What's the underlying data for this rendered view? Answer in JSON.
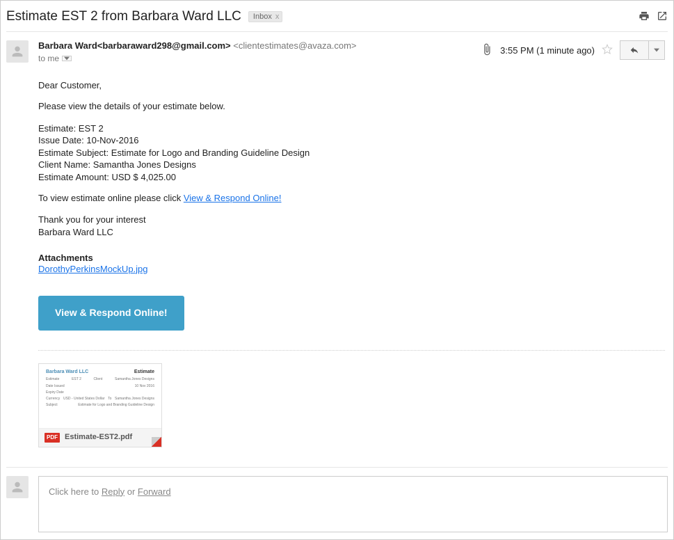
{
  "subject": "Estimate EST 2 from Barbara Ward LLC",
  "inbox_tag": "Inbox",
  "from": {
    "display": "Barbara Ward<barbaraward298@gmail.com>",
    "via": "<clientestimates@avaza.com>"
  },
  "to_line": "to me",
  "time": "3:55 PM (1 minute ago)",
  "body": {
    "greeting": "Dear Customer,",
    "intro": "Please view the details of your estimate below.",
    "lines": {
      "estimate": "Estimate: EST 2",
      "issue_date": "Issue Date: 10-Nov-2016",
      "subject": "Estimate Subject: Estimate for Logo and Branding Guideline Design",
      "client": "Client Name: Samantha Jones Designs",
      "amount": "Estimate Amount: USD $ 4,025.00"
    },
    "view_prompt": "To view estimate online please click ",
    "view_link": "View & Respond Online!",
    "thanks": "Thank you for your interest",
    "signature": "Barbara Ward LLC",
    "attachments_header": "Attachments",
    "attachment_link": "DorothyPerkinsMockUp.jpg",
    "big_button": "View & Respond Online!"
  },
  "attachment_card": {
    "preview_company": "Barbara Ward LLC",
    "preview_title": "Estimate",
    "filename": "Estimate-EST2.pdf",
    "badge": "PDF"
  },
  "reply_prompt": {
    "prefix": "Click here to ",
    "reply": "Reply",
    "mid": " or ",
    "forward": "Forward"
  }
}
